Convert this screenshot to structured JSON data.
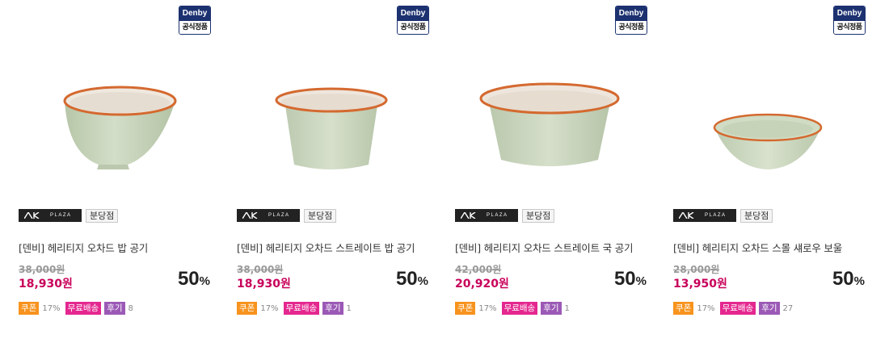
{
  "official_badge": {
    "brand": "Denby",
    "label": "공식정품"
  },
  "store": {
    "logo_text": "PLAZA",
    "branch": "분당점"
  },
  "products": [
    {
      "name": "[덴비] 헤리티지 오차드 밥 공기",
      "original_price": "38,000원",
      "sale_price": "18,930원",
      "discount_num": "50",
      "discount_sym": "%",
      "coupon_label": "쿠폰",
      "coupon_value": "17%",
      "free_shipping_label": "무료배송",
      "review_label": "후기",
      "review_count": "8",
      "image": "bowl-rice"
    },
    {
      "name": "[덴비] 헤리티지 오차드 스트레이트 밥 공기",
      "original_price": "38,000원",
      "sale_price": "18,930원",
      "discount_num": "50",
      "discount_sym": "%",
      "coupon_label": "쿠폰",
      "coupon_value": "17%",
      "free_shipping_label": "무료배송",
      "review_label": "후기",
      "review_count": "1",
      "image": "bowl-straight-rice"
    },
    {
      "name": "[덴비] 헤리티지 오차드 스트레이트 국 공기",
      "original_price": "42,000원",
      "sale_price": "20,920원",
      "discount_num": "50",
      "discount_sym": "%",
      "coupon_label": "쿠폰",
      "coupon_value": "17%",
      "free_shipping_label": "무료배송",
      "review_label": "후기",
      "review_count": "1",
      "image": "bowl-straight-soup"
    },
    {
      "name": "[덴비] 헤리티지 오차드 스몰 섀로우 보울",
      "original_price": "28,000원",
      "sale_price": "13,950원",
      "discount_num": "50",
      "discount_sym": "%",
      "coupon_label": "쿠폰",
      "coupon_value": "17%",
      "free_shipping_label": "무료배송",
      "review_label": "후기",
      "review_count": "27",
      "image": "bowl-shallow"
    }
  ],
  "colors": {
    "bowl_body": "#c9d6bd",
    "bowl_inner": "#ece5dc",
    "bowl_rim": "#d4692f",
    "sale_price": "#c8005a",
    "coupon_tag": "#f7931e",
    "free_ship_tag": "#e4278f",
    "review_tag": "#9b59b6",
    "denby_navy": "#1c3170"
  }
}
